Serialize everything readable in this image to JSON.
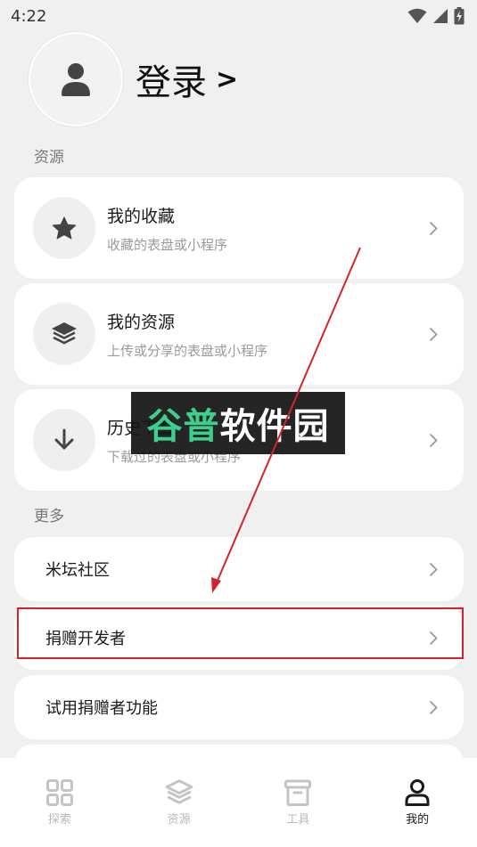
{
  "status_bar": {
    "time": "4:22"
  },
  "profile": {
    "login_label": "登录",
    "login_chevron": ">"
  },
  "sections": {
    "resources": "资源",
    "more": "更多"
  },
  "resource_cards": [
    {
      "title": "我的收藏",
      "subtitle": "收藏的表盘或小程序",
      "icon": "star-icon"
    },
    {
      "title": "我的资源",
      "subtitle": "上传或分享的表盘或小程序",
      "icon": "layers-icon"
    },
    {
      "title": "历史下载",
      "subtitle": "下载过的表盘或小程序",
      "icon": "download-icon"
    }
  ],
  "more_items": [
    {
      "title": "米坛社区"
    },
    {
      "title": "捐赠开发者"
    },
    {
      "title": "试用捐赠者功能"
    }
  ],
  "watermark": {
    "part1": "谷普",
    "part2": "软件园"
  },
  "tabs": [
    {
      "label": "探索",
      "icon": "grid-icon"
    },
    {
      "label": "资源",
      "icon": "layers-icon"
    },
    {
      "label": "工具",
      "icon": "toolbox-icon"
    },
    {
      "label": "我的",
      "icon": "user-icon"
    }
  ],
  "colors": {
    "background": "#f0f0f0",
    "card": "#ffffff",
    "annotation_red": "#d3242c",
    "watermark_green": "#3ccf8e"
  }
}
